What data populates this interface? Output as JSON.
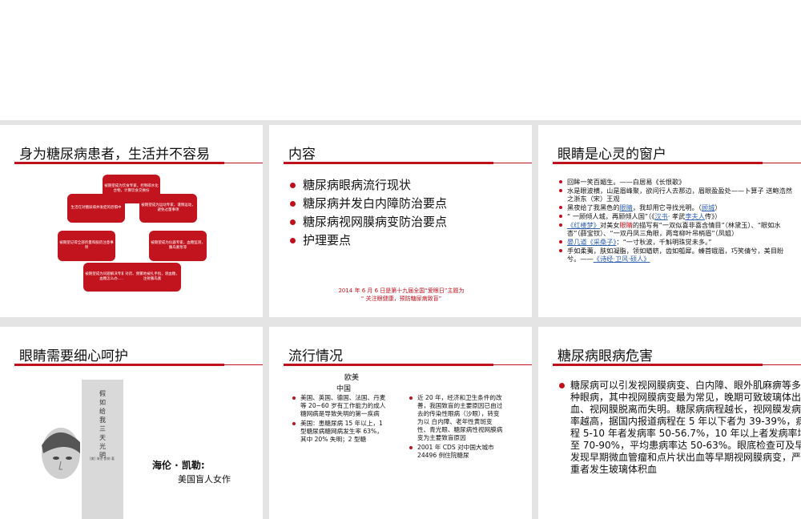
{
  "slides": [
    {
      "title": "身为糖尿病患者，生活并不容易",
      "boxes": [
        "被期望成为饮食专家，控制碳水化合物，计算饮食交换份",
        "生活在对糖尿病并发症的恐惧中",
        "被期望成为运动专家，谨慎运动，避免过量事项",
        "被期望记得全部剂量和服药注意事项",
        "被期望成为仪器专家，血糖监测，胰岛素泵等",
        "被期望成为问题解决专家，发生低血糖怎么办……",
        "对药、频繁地被扎手指，测血糖，注射胰岛素"
      ]
    },
    {
      "title": "内容",
      "bullets": [
        "糖尿病眼病流行现状",
        "糖尿病并发白内障防治要点",
        "糖尿病视网膜病变防治要点",
        "护理要点"
      ],
      "note_line1": "2014 年 6 月 6 日是第十九届全国“爱眼日”主题为",
      "note_line2": "“ 关注眼健康，预防糖尿病致盲”"
    },
    {
      "title": "眼睛是心灵的窗户",
      "lines": [
        {
          "a": "回眸一笑百媚生。——白居易《长恨歌》"
        },
        {
          "a": "水是眼波横，山是眉峰聚，欲问行人去那边，眉眼盈盈处——卜算子 送鲍浩然之浙东（宋）王观"
        },
        {
          "a": "黑夜给了我黑色的",
          "b": "眼睛",
          "c": "，我却用它寻找光明。（",
          "d": "顾城",
          "e": "）"
        },
        {
          "a": "“ 一顾倾人城，再顾倾人国”（《",
          "b": "汉书",
          "c": "· 孝武",
          "d": "李夫人",
          "e": "传》）"
        },
        {
          "a": "《红楼梦》",
          "b": "对美女",
          "c": "眼睛",
          "d": "的描写有“一双似喜非喜含情目”（林黛玉）、“眼如水杏”（薛宝钗）、“一双丹凤三角眼，两弯柳叶吊梢眉”（凤姐）"
        },
        {
          "a": "晏几道",
          "b": "《采桑子》",
          "c": "：“一寸秋波，千斛明珠觉未多。”"
        },
        {
          "a": "手如柔荑，肤如凝脂，领如蝤蛴，齿如瓠犀。螓首蛾眉，巧笑倩兮，美目盼兮。——",
          "b": "《诗经·卫风·硕人》"
        }
      ]
    },
    {
      "title": "眼睛需要细心呵护",
      "book_title": "假如给我三天光明",
      "book_small": "[美] 海伦·凯勒  著",
      "name": "海伦 · 凯勒:",
      "desc": "美国盲人女作"
    },
    {
      "title": "流行情况",
      "center1": "欧美",
      "center2": "中国",
      "left_items": [
        "美国、英国、德国、法国、丹麦等 20~60 岁有工作能力的成人糖网病是导致失明的第一疾病",
        "美国：患糖尿病 15 年以上，1 型糖尿病糖网病发生率 63%，其中 20% 失明；2 型糖"
      ],
      "right_items": [
        "近 20 年，经济和卫生条件的改善，我国致盲的主要原因已由过去的传染性眼病（沙眼），转变为以 白内障、老年性黄斑变性、青光眼、糖尿病性视网膜病变为主要致盲原因",
        "2001 年 CDS 对中国大城市 24496 例住院糖尿"
      ]
    },
    {
      "title": "糖尿病眼病危害",
      "text": "糖尿病可以引发视网膜病变、白内障、眼外肌麻痹等多种眼病，其中视网膜病变最为常见，晚期可致玻璃体出血、视网膜脱离而失明。糖尿病病程越长，视网膜发病率越高，据国内报道病程在 5 年以下者为 39-39%，病程 5-10 年者发病率 50-56.7%，10 年以上者发病率增至 70-90%，平均患病率达 50-63%。眼底检查可及早发现早期微血管瘤和点片状出血等早期视网膜病变，严重者发生玻璃体积血"
    }
  ],
  "accent": "#c0101c"
}
